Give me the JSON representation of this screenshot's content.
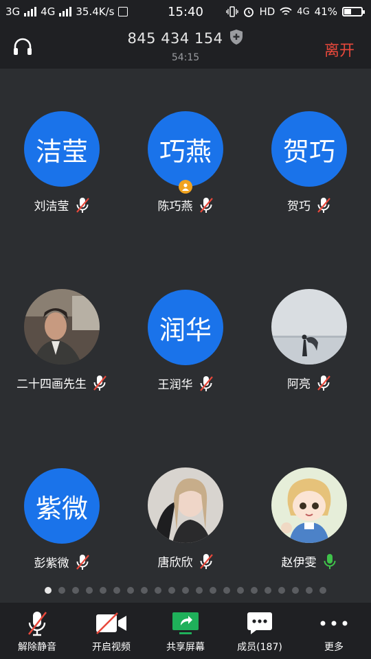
{
  "status_bar": {
    "net1": "3G",
    "net2": "4G",
    "speed": "35.4K/s",
    "time": "15:40",
    "hd": "HD",
    "net3": "4G",
    "battery": "41%",
    "battery_level": 0.41
  },
  "header": {
    "meeting_id": "845 434 154",
    "duration": "54:15",
    "leave_label": "离开"
  },
  "participants": [
    {
      "avatar_text": "洁莹",
      "name": "刘洁莹",
      "mic": "muted"
    },
    {
      "avatar_text": "巧燕",
      "name": "陈巧燕",
      "mic": "muted",
      "host": true
    },
    {
      "avatar_text": "贺巧",
      "name": "贺巧",
      "mic": "muted"
    },
    {
      "avatar_text": "",
      "name": "二十四画先生",
      "mic": "muted",
      "photo": "man-in-car"
    },
    {
      "avatar_text": "润华",
      "name": "王润华",
      "mic": "muted"
    },
    {
      "avatar_text": "",
      "name": "阿亮",
      "mic": "muted",
      "photo": "figure-on-beach"
    },
    {
      "avatar_text": "紫微",
      "name": "彭紫微",
      "mic": "muted"
    },
    {
      "avatar_text": "",
      "name": "唐欣欣",
      "mic": "muted",
      "photo": "girl-portrait"
    },
    {
      "avatar_text": "",
      "name": "赵伊雯",
      "mic": "active",
      "photo": "anime-character"
    }
  ],
  "pagination": {
    "total_pages": 21,
    "current_page": 1
  },
  "toolbar": {
    "unmute_label": "解除静音",
    "video_label": "开启视频",
    "share_label": "共享屏幕",
    "members_label": "成员(187)",
    "more_label": "更多"
  },
  "colors": {
    "accent_blue": "#1a73ea",
    "leave_red": "#e8483b",
    "mute_red": "#e8483b",
    "mic_green": "#3fc24a",
    "share_green": "#1fb05a",
    "host_badge": "#f0a21f"
  }
}
